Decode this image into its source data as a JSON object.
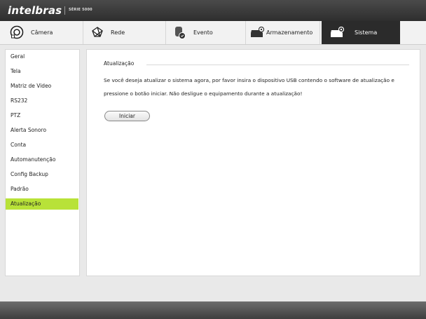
{
  "header": {
    "brand": "intelbras",
    "series": "SÉRIE 5000"
  },
  "tabs": [
    {
      "label": "Câmera",
      "icon": "camera-icon"
    },
    {
      "label": "Rede",
      "icon": "network-icon"
    },
    {
      "label": "Evento",
      "icon": "event-icon"
    },
    {
      "label": "Armazenamento",
      "icon": "storage-icon"
    },
    {
      "label": "Sistema",
      "icon": "system-icon",
      "active": true
    }
  ],
  "sidebar": {
    "items": [
      {
        "label": "Geral"
      },
      {
        "label": "Tela"
      },
      {
        "label": "Matriz de Video"
      },
      {
        "label": "RS232"
      },
      {
        "label": "PTZ"
      },
      {
        "label": "Alerta Sonoro"
      },
      {
        "label": "Conta"
      },
      {
        "label": "Automanutenção"
      },
      {
        "label": "Config Backup"
      },
      {
        "label": "Padrão"
      },
      {
        "label": "Atualização",
        "active": true
      }
    ]
  },
  "main": {
    "section_title": "Atualização",
    "message": "Se você deseja atualizar o sistema agora, por favor insira o dispositivo USB contendo o software de atualização e pressione o botão iniciar. Não desligue o equipamento durante a atualização!",
    "start_button": "Iniciar"
  },
  "colors": {
    "accent": "#b8e238",
    "topbar": "#333333",
    "active_tab": "#2b2b2b"
  }
}
